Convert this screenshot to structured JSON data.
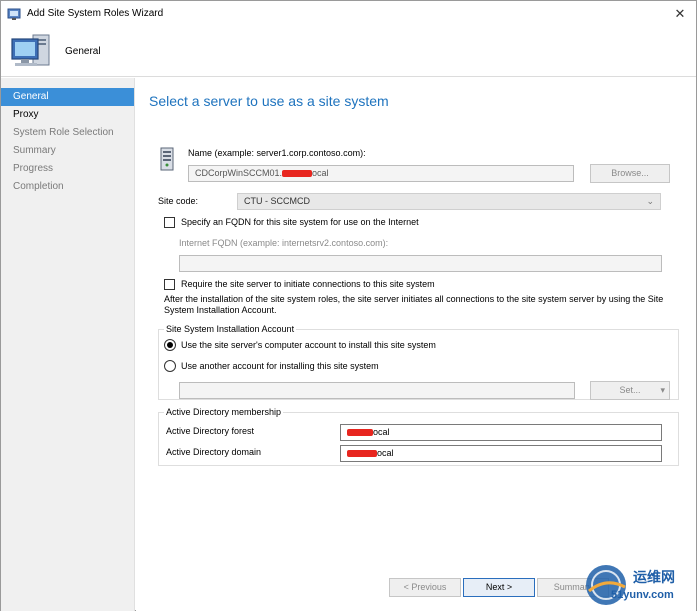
{
  "window": {
    "title": "Add Site System Roles Wizard",
    "close_label": "✕"
  },
  "header": {
    "title": "General"
  },
  "sidebar": {
    "items": [
      {
        "label": "General"
      },
      {
        "label": "Proxy"
      },
      {
        "label": "System Role Selection"
      },
      {
        "label": "Summary"
      },
      {
        "label": "Progress"
      },
      {
        "label": "Completion"
      }
    ]
  },
  "main": {
    "heading": "Select a server to use as a site system",
    "name_label": "Name (example: server1.corp.contoso.com):",
    "name_value_prefix": "CDCorpWinSCCM01.",
    "name_value_suffix": "ocal",
    "browse_label": "Browse...",
    "site_code_label": "Site code:",
    "site_code_value": "CTU - SCCMCD",
    "fqdn_checkbox_label": "Specify an FQDN for this site system for use on the Internet",
    "fqdn_label": "Internet FQDN (example: internetsrv2.contoso.com):",
    "require_checkbox_label": "Require the site server to initiate connections to this site system",
    "require_note": "After the  installation of the site system roles, the site server initiates all connections to the site system server by using the Site System Installation Account.",
    "install_account_group": "Site System Installation Account",
    "radio_computer_account": "Use the site server's computer account to install this site system",
    "radio_another_account": "Use another account for installing this site system",
    "set_label": "Set...",
    "ad_group": "Active Directory membership",
    "ad_forest_label": "Active Directory forest",
    "ad_forest_suffix": "ocal",
    "ad_domain_label": "Active Directory domain",
    "ad_domain_suffix": "ocal"
  },
  "footer": {
    "previous_label": "< Previous",
    "next_label": "Next >",
    "summary_label": "Summary"
  },
  "watermark": {
    "cn_text": "运维网",
    "url_text": "51yunv.com"
  }
}
